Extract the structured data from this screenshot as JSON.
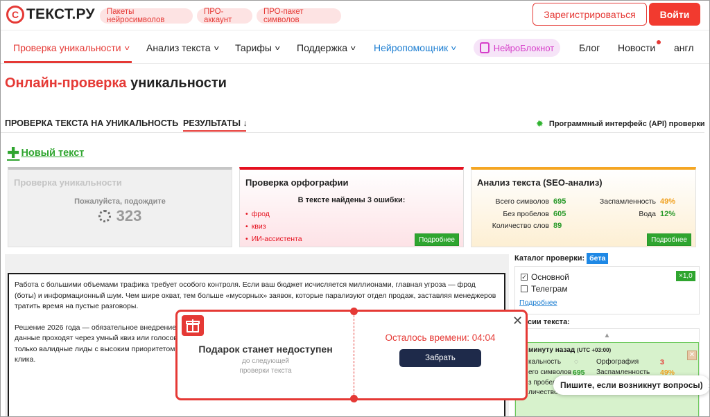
{
  "header": {
    "logo_mark": "C",
    "logo_text": "ТЕКСТ.РУ",
    "pills": [
      "Пакеты нейросимволов",
      "ПРО-аккаунт",
      "ПРО-пакет символов"
    ],
    "register_label": "Зарегистрироваться",
    "login_label": "Войти"
  },
  "nav": {
    "items": [
      "Проверка уникальности",
      "Анализ текста",
      "Тарифы",
      "Поддержка",
      "Нейропомощник"
    ],
    "neuro_label": "НейроБлокнот",
    "blog": "Блог",
    "news": "Новости",
    "lang": "англ"
  },
  "page": {
    "title_red": "Онлайн-проверка",
    "title_rest": "уникальности",
    "step1": "ПРОВЕРКА ТЕКСТА НА УНИКАЛЬНОСТЬ",
    "step2": "РЕЗУЛЬТАТЫ ↓",
    "api_link": "Программный интерфейс (API) проверки",
    "new_text": "Новый текст"
  },
  "cards": {
    "uniq": {
      "title": "Проверка уникальности",
      "wait": "Пожалуйста, подождите",
      "count": "323"
    },
    "spell": {
      "title": "Проверка орфографии",
      "found": "В тексте найдены 3 ошибки:",
      "errors": [
        "фрод",
        "квиз",
        "ИИ-ассистента"
      ],
      "more": "Подробнее"
    },
    "seo": {
      "title": "Анализ текста (SEO-анализ)",
      "total_label": "Всего символов",
      "total": "695",
      "nospace_label": "Без пробелов",
      "nospace": "605",
      "words_label": "Количество слов",
      "words": "89",
      "spam_label": "Заспамленность",
      "spam": "49%",
      "water_label": "Вода",
      "water": "12%",
      "more": "Подробнее"
    }
  },
  "textarea": {
    "p1": "Работа с большими объемами трафика требует особого контроля. Если ваш бюджет исчисляется миллионами, главная угроза — фрод (боты) и информационный шум. Чем шире охват, тем больше «мусорных» заявок, которые парализуют отдел продаж, заставляя менеджеров тратить время на пустые разговоры.",
    "p2_line1": "Решение 2026 года — обязательное внедрение AI",
    "p2_line2": "данные проходят через умный квиз или голосово",
    "p2_line3": "только валидные лиды с высоким приоритетом. Э",
    "p2_line4": "клика."
  },
  "catalog": {
    "title": "Каталог проверки:",
    "beta": "бета",
    "items": [
      {
        "label": "Основной",
        "checked": "✓"
      },
      {
        "label": "Телеграм",
        "checked": ""
      }
    ],
    "multiplier": "×1,0",
    "more": "Подробнее"
  },
  "versions": {
    "title": "сии текста:",
    "time": "минуту назад",
    "tz": "(UTC +03:00)",
    "l_uniq": "кальность",
    "l_spell": "Орфография",
    "v_spell": "3",
    "l_total": "его символов",
    "v_total": "695",
    "l_spam": "Заспамленность",
    "v_spam": "49%",
    "l_nospace": "з пробело",
    "l_words": "личество"
  },
  "chat": {
    "label": "Пишите, если возникнут вопросы)"
  },
  "popup": {
    "title": "Подарок станет недоступен",
    "subtitle": "до следующей проверки текста",
    "timer": "Осталось времени: 04:04",
    "button": "Забрать"
  }
}
